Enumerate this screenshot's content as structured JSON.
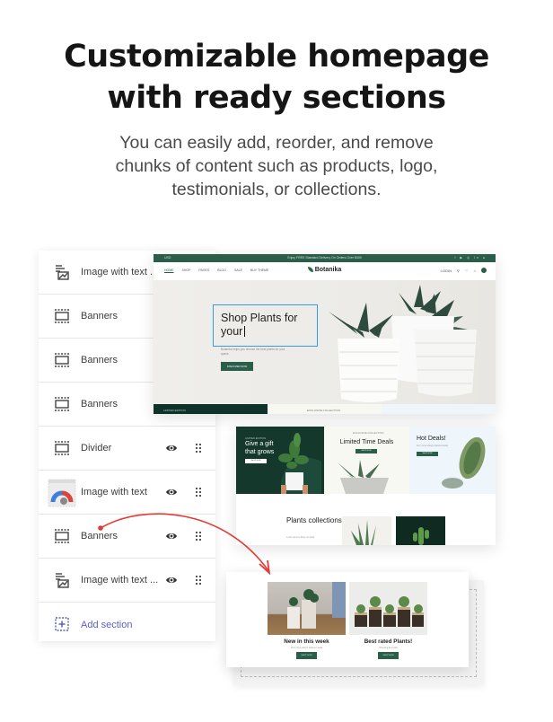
{
  "header": {
    "title_line1": "Customizable homepage",
    "title_line2": "with ready sections",
    "subtitle": "You can easily add, reorder, and remove chunks of content such as products, logo, testimonials, or collections."
  },
  "sections_panel": {
    "items": [
      {
        "label": "Image with text ...",
        "icon": "image-with-text-icon",
        "show_controls": false
      },
      {
        "label": "Banners",
        "icon": "banners-icon",
        "show_controls": false
      },
      {
        "label": "Banners",
        "icon": "banners-icon",
        "show_controls": false
      },
      {
        "label": "Banners",
        "icon": "banners-icon",
        "show_controls": false
      },
      {
        "label": "Divider",
        "icon": "banners-icon",
        "show_controls": true
      },
      {
        "label": "Image with text",
        "icon": "gauge-thumbnail-icon",
        "show_controls": true
      },
      {
        "label": "Banners",
        "icon": "banners-icon",
        "show_controls": true
      },
      {
        "label": "Image with text ...",
        "icon": "image-with-text-icon",
        "show_controls": true
      }
    ],
    "add_section_label": "Add section",
    "visibility_icon": "eye-icon",
    "drag_icon": "drag-handle-icon"
  },
  "storefront": {
    "announcement": {
      "currency": "USD",
      "message": "Enjoy FREE Standard Delivery On Orders Over $400",
      "social_icons": [
        "facebook-icon",
        "youtube-icon",
        "instagram-icon",
        "linkedin-icon",
        "pinterest-icon"
      ]
    },
    "nav_links": [
      "HOME",
      "SHOP",
      "PAGES",
      "BLOG",
      "SALE",
      "BUY THEME"
    ],
    "brand": "Botanika",
    "nav_right": {
      "account": "LOGIN",
      "cart_count": "0"
    },
    "hero": {
      "editing_text": "Shop Plants for your",
      "description": "Botanika helps you choose the best plants for your space.",
      "button_label": "DISCOVER NOW"
    },
    "strip_labels": [
      "LIMITED EDITION",
      "EXCLUSIVE COLLECTION",
      ""
    ]
  },
  "banners": [
    {
      "tag": "LIMITED EDITION",
      "title": "Give a gift that grows",
      "button": "SHOP NOW"
    },
    {
      "tag": "EXCLUSIVE COLLECTION",
      "title": "Limited Time Deals",
      "button": "SHOP NOW"
    },
    {
      "tag": "",
      "title": "Hot Deals!",
      "description": "Don't miss today's featured deals",
      "button": "SHOP NOW"
    }
  ],
  "plants_collections": {
    "title": "Plants collections",
    "description": "Lorem ipsum dolor sit amet",
    "link": "EXPLORE COLLECTIONS"
  },
  "dropped_section": {
    "cards": [
      {
        "title": "New in this week",
        "subtitle": "Don't miss today's featured deals",
        "button": "SHOP NOW"
      },
      {
        "title": "Best rated Plants!",
        "subtitle": "Shopping Everyday",
        "button": "SHOP NOW"
      }
    ]
  },
  "colors": {
    "brand_green": "#2b5d4b",
    "dark_green": "#15382c",
    "selection_blue": "#3b9ae6",
    "arrow_red": "#e53935",
    "add_section_purple": "#5a5fc9"
  }
}
